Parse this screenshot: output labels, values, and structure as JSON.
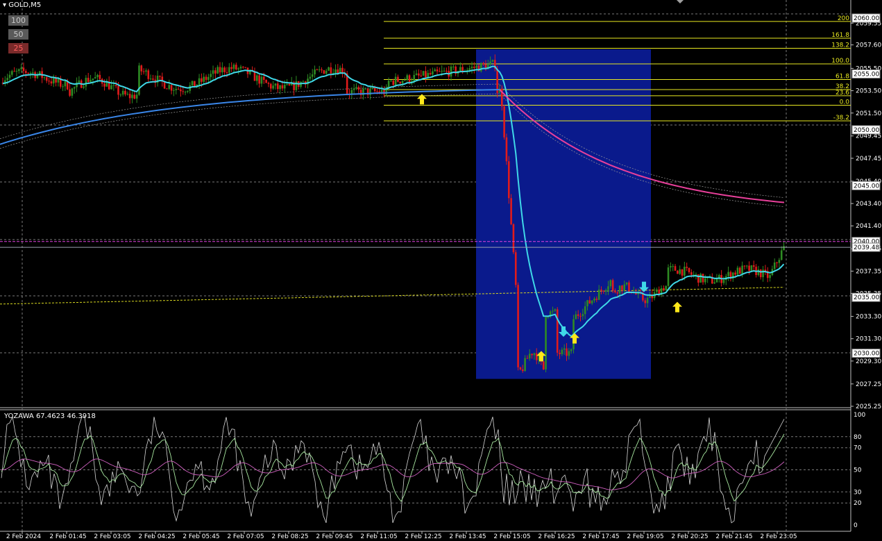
{
  "window": {
    "title_arrow": "▾",
    "title": "GOLD,M5"
  },
  "zoom_buttons": [
    "100",
    "50",
    "25"
  ],
  "oscillator": {
    "label": "YOZAWA 67.4623 46.3918"
  },
  "colors": {
    "bull": "#2e8b23",
    "bear": "#e11b1b",
    "box": "#0a1a8c",
    "fib": "#e8e820",
    "ma_fast": "#3fd8e8",
    "ma_slow": "#3a86e8",
    "ma_pink": "#e8409a"
  },
  "chart_data": {
    "type": "candlestick",
    "symbol": "GOLD",
    "timeframe": "M5",
    "ylim": [
      2025.25,
      2060.5
    ],
    "price_ticks": [
      "2059.55",
      "2057.60",
      "2055.50",
      "2053.50",
      "2051.50",
      "2049.45",
      "2047.45",
      "2045.40",
      "2043.40",
      "2041.40",
      "2039.35",
      "2037.35",
      "2035.35",
      "2033.30",
      "2031.30",
      "2029.30",
      "2027.25",
      "2025.25"
    ],
    "price_tags": [
      {
        "label": "2060.00",
        "value": 2060.0
      },
      {
        "label": "2055.00",
        "value": 2055.0
      },
      {
        "label": "2050.00",
        "value": 2050.0
      },
      {
        "label": "2045.00",
        "value": 2045.0
      },
      {
        "label": "2040.00",
        "value": 2040.0
      },
      {
        "label": "2039.48",
        "value": 2039.48
      },
      {
        "label": "2035.00",
        "value": 2035.0
      },
      {
        "label": "2030.00",
        "value": 2030.0
      }
    ],
    "time_labels": [
      "2 Feb 2024",
      "2 Feb 01:45",
      "2 Feb 03:05",
      "2 Feb 04:25",
      "2 Feb 05:45",
      "2 Feb 07:05",
      "2 Feb 08:25",
      "2 Feb 09:45",
      "2 Feb 11:05",
      "2 Feb 12:25",
      "2 Feb 13:45",
      "2 Feb 15:05",
      "2 Feb 16:25",
      "2 Feb 17:45",
      "2 Feb 19:05",
      "2 Feb 20:25",
      "2 Feb 21:45",
      "2 Feb 23:05"
    ],
    "fibonacci": [
      {
        "label": "200",
        "value": 2059.7
      },
      {
        "label": "161.8",
        "value": 2058.2
      },
      {
        "label": "138.2",
        "value": 2057.3
      },
      {
        "label": "100.0",
        "value": 2055.9
      },
      {
        "label": "61.8",
        "value": 2054.5
      },
      {
        "label": "38.2",
        "value": 2053.6
      },
      {
        "label": "23.6",
        "value": 2053.05
      },
      {
        "label": "0.0",
        "value": 2052.2
      },
      {
        "label": "-38.2",
        "value": 2050.8
      }
    ],
    "box": {
      "time_start": "2 Feb 13:45",
      "time_end": "2 Feb 19:15",
      "high": 2057.2,
      "low": 2027.7
    },
    "signal_arrows": [
      {
        "dir": "up",
        "color": "yellow",
        "time": "2 Feb 12:25",
        "price": 2053.2
      },
      {
        "dir": "up",
        "color": "yellow",
        "time": "2 Feb 16:00",
        "price": 2030.2
      },
      {
        "dir": "down",
        "color": "cyan",
        "time": "2 Feb 16:40",
        "price": 2032.4
      },
      {
        "dir": "up",
        "color": "yellow",
        "time": "2 Feb 17:00",
        "price": 2031.8
      },
      {
        "dir": "down",
        "color": "cyan",
        "time": "2 Feb 19:05",
        "price": 2036.4
      },
      {
        "dir": "up",
        "color": "yellow",
        "time": "2 Feb 20:05",
        "price": 2034.6
      }
    ],
    "oscillator": {
      "name": "YOZAWA",
      "values": [
        67.4623,
        46.3918
      ],
      "levels": [
        100,
        80,
        70,
        50,
        30,
        20,
        0
      ]
    }
  }
}
